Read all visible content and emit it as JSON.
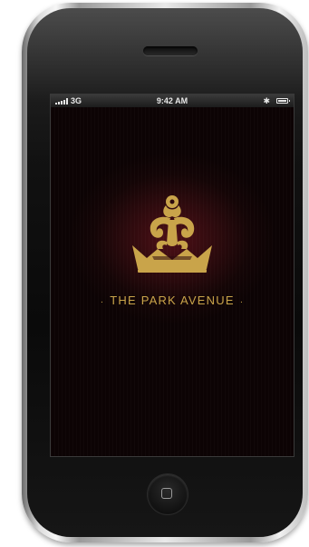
{
  "status_bar": {
    "carrier": "3G",
    "time": "9:42 AM",
    "bluetooth_icon": "bluetooth-icon",
    "battery_icon": "battery-icon",
    "signal_icon": "signal-bars-icon"
  },
  "app": {
    "brand_name": "THE PARK AVENUE",
    "separator": "·",
    "logo_icon": "crown-fleur-logo",
    "colors": {
      "gold": "#c9a44a",
      "background": "#2c0a0d"
    }
  },
  "device": {
    "home_icon": "home-button-icon"
  }
}
